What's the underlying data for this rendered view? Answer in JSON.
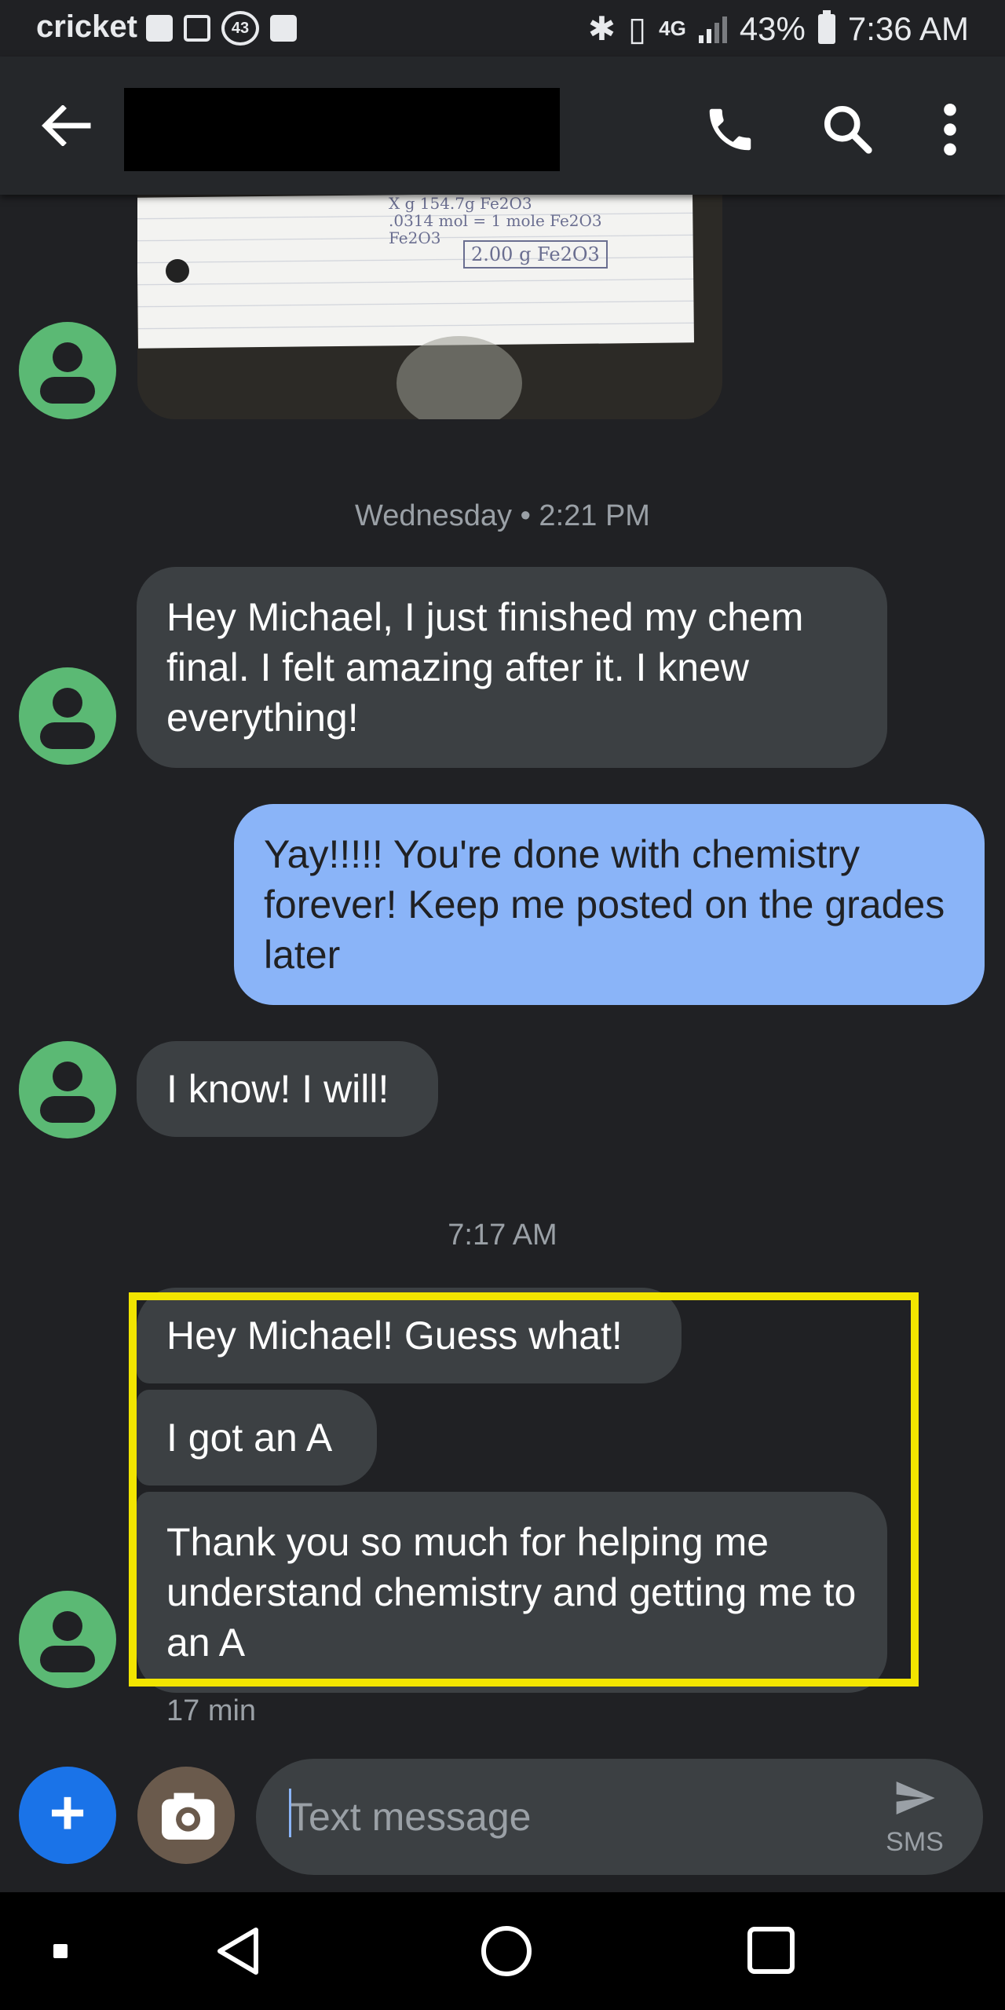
{
  "status_bar": {
    "carrier": "cricket",
    "notification_count": "43",
    "battery": "43%",
    "time": "7:36 AM",
    "network": "4G LTE"
  },
  "header": {
    "contact_name_redacted": true,
    "icons": [
      "back-arrow-icon",
      "phone-icon",
      "search-icon",
      "more-vert-icon"
    ]
  },
  "image_message": {
    "note_lines": [
      "X g   154.7g Fe2O3",
      ".0314 mol =  1 mole Fe2O3",
      "Fe2O3"
    ],
    "boxed_answer": "2.00 g Fe2O3"
  },
  "timestamps": {
    "wednesday": "Wednesday • 2:21 PM",
    "morning": "7:17 AM",
    "relative": "17 min"
  },
  "messages": {
    "m1": "Hey Michael, I just finished my chem final. I felt amazing after it. I knew everything!",
    "m2": "Yay!!!!! You're done with chemistry forever! Keep me posted on the grades later",
    "m3": "I know! I will!",
    "m4": "Hey Michael! Guess what!",
    "m5": "I got an A",
    "m6": "Thank you so much for helping me understand chemistry and getting me to an A"
  },
  "compose": {
    "placeholder": "Text message",
    "send_label": "SMS"
  },
  "colors": {
    "background": "#202124",
    "incoming_bubble": "#3c4043",
    "outgoing_bubble": "#8ab4f8",
    "avatar": "#5bb974",
    "highlight_box": "#f2e500",
    "fab": "#1a73e8"
  }
}
